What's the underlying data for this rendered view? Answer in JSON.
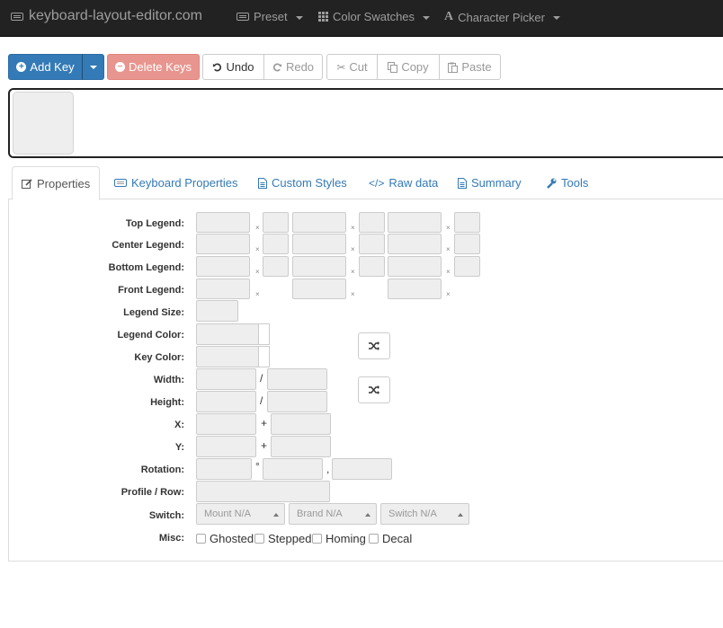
{
  "navbar": {
    "brand": "keyboard-layout-editor.com",
    "preset": "Preset",
    "color_swatches": "Color Swatches",
    "character_picker": "Character Picker"
  },
  "toolbar": {
    "add_key": "Add Key",
    "delete_keys": "Delete Keys",
    "undo": "Undo",
    "redo": "Redo",
    "cut": "Cut",
    "copy": "Copy",
    "paste": "Paste"
  },
  "tabs": {
    "properties": "Properties",
    "keyboard_properties": "Keyboard Properties",
    "custom_styles": "Custom Styles",
    "raw_data": "Raw data",
    "summary": "Summary",
    "tools": "Tools"
  },
  "form": {
    "top_legend": "Top Legend:",
    "center_legend": "Center Legend:",
    "bottom_legend": "Bottom Legend:",
    "front_legend": "Front Legend:",
    "legend_size": "Legend Size:",
    "legend_color": "Legend Color:",
    "key_color": "Key Color:",
    "width": "Width:",
    "height": "Height:",
    "x": "X:",
    "y": "Y:",
    "rotation": "Rotation:",
    "profile_row": "Profile / Row:",
    "switch": "Switch:",
    "misc": "Misc:",
    "clear_glyph": "×",
    "slash": "/",
    "plus": "+",
    "degree": "°",
    "comma": ","
  },
  "switch": {
    "mount": "Mount N/A",
    "brand": "Brand N/A",
    "switch": "Switch N/A"
  },
  "misc": {
    "ghosted": "Ghosted",
    "stepped": "Stepped",
    "homing": "Homing",
    "decal": "Decal"
  }
}
